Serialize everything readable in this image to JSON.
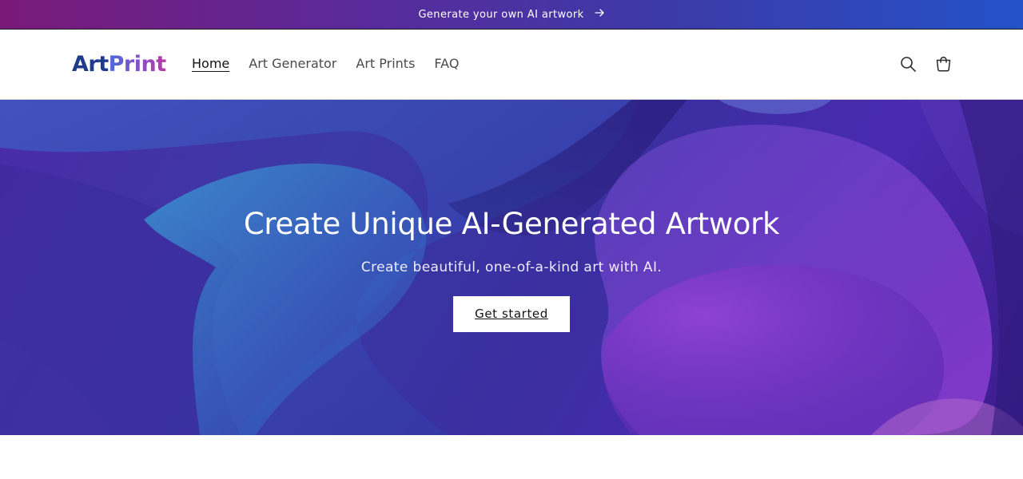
{
  "announcement": {
    "text": "Generate your own AI artwork",
    "arrow_icon": "arrow-right-icon"
  },
  "header": {
    "logo": {
      "part1": "Art",
      "part2": "Print"
    },
    "nav": [
      {
        "label": "Home",
        "active": true
      },
      {
        "label": "Art Generator",
        "active": false
      },
      {
        "label": "Art Prints",
        "active": false
      },
      {
        "label": "FAQ",
        "active": false
      }
    ],
    "icons": {
      "search": "search-icon",
      "cart": "cart-icon"
    }
  },
  "hero": {
    "title": "Create Unique AI-Generated Artwork",
    "subtitle": "Create beautiful, one-of-a-kind art with AI.",
    "button_label": "Get started"
  },
  "colors": {
    "announce_gradient_start": "#7a1a78",
    "announce_gradient_end": "#2452c8",
    "logo_art": "#1f3b8c",
    "logo_print_start": "#4a6ad8",
    "logo_print_end": "#b53aa8",
    "hero_base": "#3b3aa6"
  }
}
